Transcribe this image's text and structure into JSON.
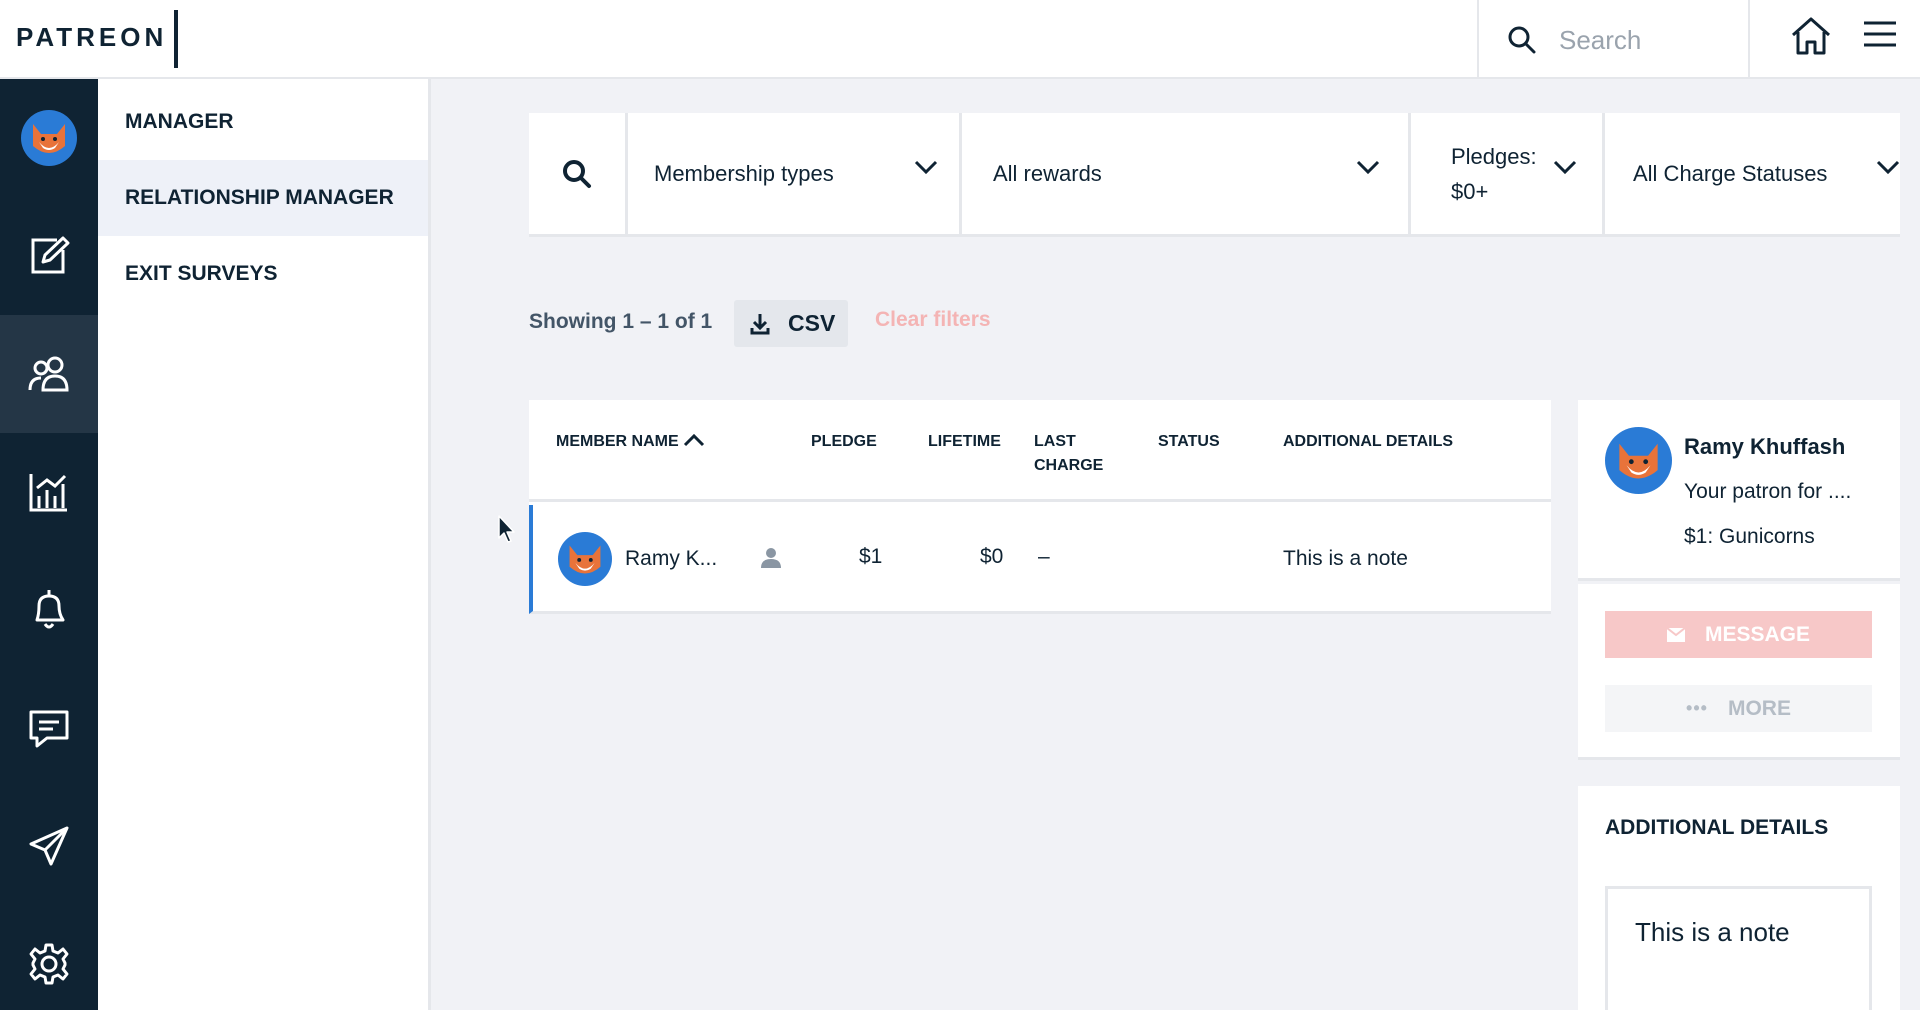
{
  "header": {
    "logo": "PATREON",
    "search_placeholder": "Search"
  },
  "subnav": {
    "items": [
      {
        "label": "MANAGER",
        "active": false
      },
      {
        "label": "RELATIONSHIP MANAGER",
        "active": true
      },
      {
        "label": "EXIT SURVEYS",
        "active": false
      }
    ]
  },
  "rail": {
    "icons": [
      "avatar",
      "edit-icon",
      "users-icon",
      "analytics-icon",
      "notification-bell-icon",
      "messages-icon",
      "send-icon",
      "settings-gear-icon"
    ],
    "active": "users-icon"
  },
  "filters": {
    "membership": "Membership types",
    "rewards": "All rewards",
    "pledges_line1": "Pledges:",
    "pledges_line2": "$0+",
    "charge_status": "All Charge Statuses"
  },
  "results": {
    "showing": "Showing 1 – 1 of 1",
    "csv_label": "CSV",
    "clear_filters": "Clear filters"
  },
  "table": {
    "columns": {
      "member_name": "MEMBER NAME",
      "pledge": "PLEDGE",
      "lifetime": "LIFETIME",
      "last_charge_1": "LAST",
      "last_charge_2": "CHARGE",
      "status": "STATUS",
      "additional_details": "ADDITIONAL DETAILS"
    },
    "rows": [
      {
        "name": "Ramy K...",
        "pledge": "$1",
        "lifetime": "$0",
        "last_charge": "–",
        "status": "",
        "details": "This is a note"
      }
    ]
  },
  "panel": {
    "name": "Ramy Khuffash",
    "subtitle": "Your patron for ....",
    "tier": "$1: Gunicorns",
    "message_label": "MESSAGE",
    "more_label": "MORE",
    "details_title": "ADDITIONAL DETAILS",
    "note": "This is a note"
  },
  "colors": {
    "navy": "#0f2333",
    "accent_blue": "#2a7bd6",
    "fox_orange": "#e8733a",
    "disabled_coral": "#f7c8c8"
  }
}
